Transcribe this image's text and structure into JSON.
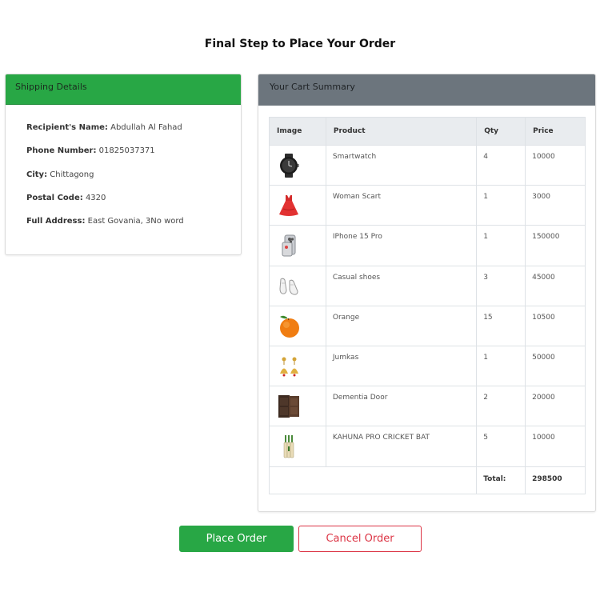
{
  "page": {
    "title": "Final Step to Place Your Order"
  },
  "shipping": {
    "header": "Shipping Details",
    "fields": [
      {
        "label": "Recipient's Name:",
        "value": "Abdullah Al Fahad"
      },
      {
        "label": "Phone Number:",
        "value": "01825037371"
      },
      {
        "label": "City:",
        "value": "Chittagong"
      },
      {
        "label": "Postal Code:",
        "value": "4320"
      },
      {
        "label": "Full Address:",
        "value": "East Govania, 3No word"
      }
    ]
  },
  "cart": {
    "header": "Your Cart Summary",
    "columns": [
      "Image",
      "Product",
      "Qty",
      "Price"
    ],
    "items": [
      {
        "product": "Smartwatch",
        "qty": "4",
        "price": "10000",
        "icon": "smartwatch-icon"
      },
      {
        "product": "Woman Scart",
        "qty": "1",
        "price": "3000",
        "icon": "red-dress-icon"
      },
      {
        "product": "IPhone 15 Pro",
        "qty": "1",
        "price": "150000",
        "icon": "phone-icon"
      },
      {
        "product": "Casual shoes",
        "qty": "3",
        "price": "45000",
        "icon": "shoes-icon"
      },
      {
        "product": "Orange",
        "qty": "15",
        "price": "10500",
        "icon": "orange-icon"
      },
      {
        "product": "Jumkas",
        "qty": "1",
        "price": "50000",
        "icon": "earrings-icon"
      },
      {
        "product": "Dementia Door",
        "qty": "2",
        "price": "20000",
        "icon": "door-icon"
      },
      {
        "product": "KAHUNA PRO CRICKET BAT",
        "qty": "5",
        "price": "10000",
        "icon": "cricket-bat-icon"
      }
    ],
    "total_label": "Total:",
    "total_value": "298500"
  },
  "actions": {
    "place_label": "Place Order",
    "cancel_label": "Cancel Order"
  },
  "colors": {
    "success": "#28a745",
    "secondary": "#6c757d",
    "danger": "#dc3545"
  }
}
